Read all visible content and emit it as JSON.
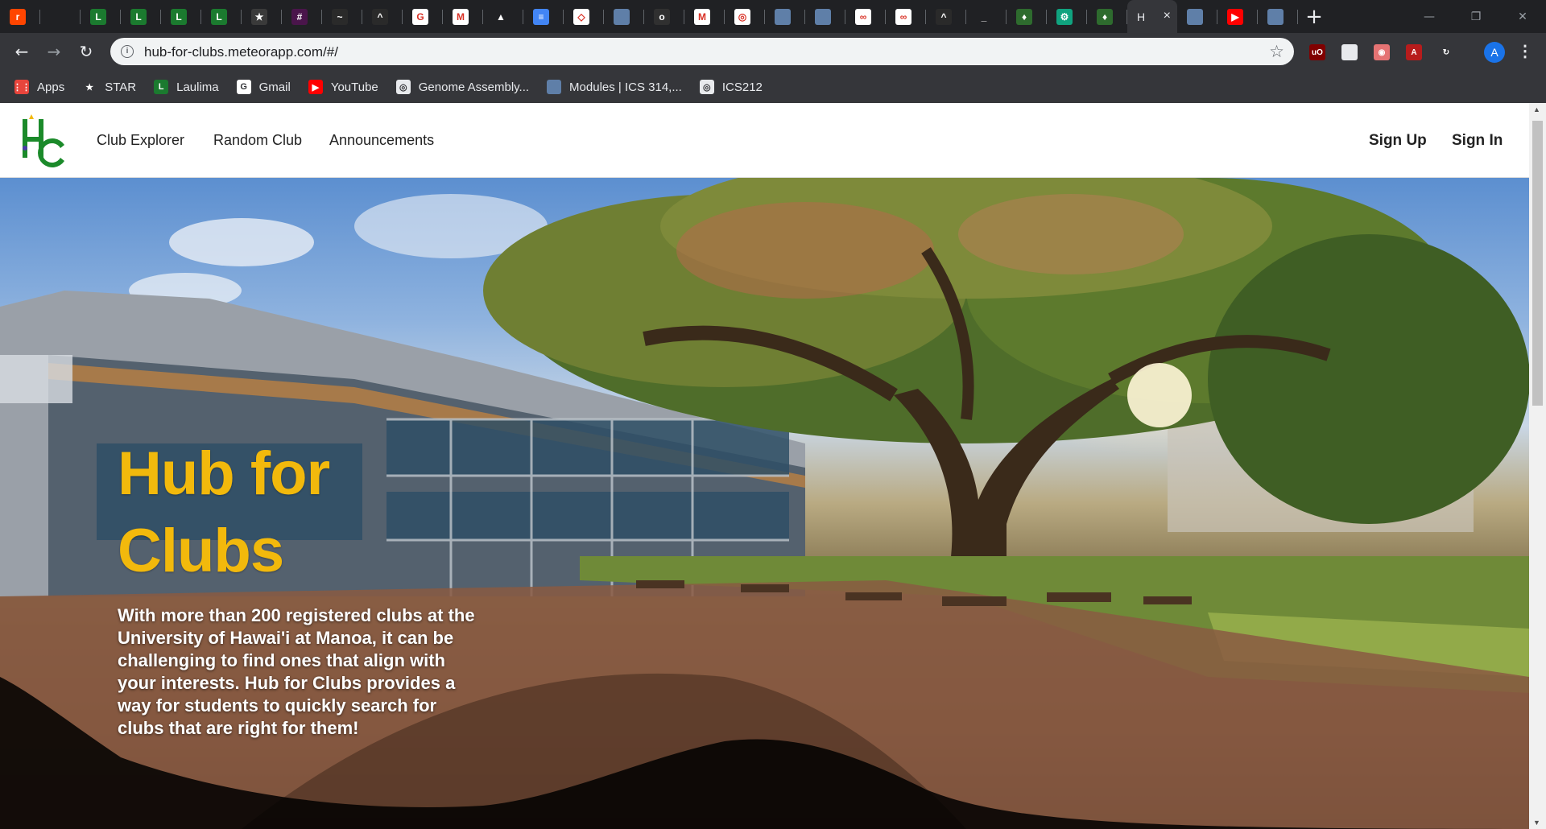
{
  "browser": {
    "tabs": [
      {
        "icon": "reddit-icon",
        "color": "#ff4500",
        "glyph": "r"
      },
      {
        "icon": "blank-tab-icon",
        "color": "#202124",
        "glyph": ""
      },
      {
        "icon": "laulima-icon",
        "color": "#1b7a2f",
        "glyph": "L"
      },
      {
        "icon": "laulima-icon",
        "color": "#1b7a2f",
        "glyph": "L"
      },
      {
        "icon": "laulima-icon",
        "color": "#1b7a2f",
        "glyph": "L"
      },
      {
        "icon": "laulima-icon",
        "color": "#1b7a2f",
        "glyph": "L"
      },
      {
        "icon": "star-icon",
        "color": "#3a3a3a",
        "glyph": "★"
      },
      {
        "icon": "slack-icon",
        "color": "#4a154b",
        "glyph": "#"
      },
      {
        "icon": "feather-icon",
        "color": "#2a2a2a",
        "glyph": "~"
      },
      {
        "icon": "flame-icon",
        "color": "#2a2a2a",
        "glyph": "^"
      },
      {
        "icon": "google-icon",
        "color": "#ffffff",
        "glyph": "G"
      },
      {
        "icon": "gmail-icon",
        "color": "#ffffff",
        "glyph": "M"
      },
      {
        "icon": "drive-icon",
        "color": "#202124",
        "glyph": "▲"
      },
      {
        "icon": "docs-icon",
        "color": "#4285f4",
        "glyph": "≡"
      },
      {
        "icon": "codepen-icon",
        "color": "#ffffff",
        "glyph": "◇"
      },
      {
        "icon": "page-icon",
        "color": "#5f7fa8",
        "glyph": ""
      },
      {
        "icon": "github-icon",
        "color": "#303030",
        "glyph": "o"
      },
      {
        "icon": "mendeley-icon",
        "color": "#ffffff",
        "glyph": "M"
      },
      {
        "icon": "globe-icon",
        "color": "#ffffff",
        "glyph": "◎"
      },
      {
        "icon": "page-icon",
        "color": "#5f7fa8",
        "glyph": ""
      },
      {
        "icon": "page-icon",
        "color": "#5f7fa8",
        "glyph": ""
      },
      {
        "icon": "link-icon",
        "color": "#ffffff",
        "glyph": "∞"
      },
      {
        "icon": "link-icon",
        "color": "#ffffff",
        "glyph": "∞"
      },
      {
        "icon": "flame-icon",
        "color": "#2a2a2a",
        "glyph": "^"
      },
      {
        "icon": "dash-icon",
        "color": "#202124",
        "glyph": "_"
      },
      {
        "icon": "leaf-icon",
        "color": "#2e6b2e",
        "glyph": "♦"
      },
      {
        "icon": "openai-icon",
        "color": "#10a37f",
        "glyph": "⚙"
      },
      {
        "icon": "leaf-icon",
        "color": "#2e6b2e",
        "glyph": "♦"
      }
    ],
    "active_tab": {
      "icon": "hub-for-clubs-icon",
      "title_fragment": "H",
      "close": "×"
    },
    "tabs_after": [
      {
        "icon": "page-icon",
        "color": "#5f7fa8",
        "glyph": ""
      },
      {
        "icon": "youtube-icon",
        "color": "#ff0000",
        "glyph": "▶"
      },
      {
        "icon": "page-icon",
        "color": "#5f7fa8",
        "glyph": ""
      }
    ],
    "new_tab": "+",
    "window_controls": {
      "minimize": "—",
      "maximize": "❐",
      "close": "✕"
    },
    "nav": {
      "back": "←",
      "forward": "→",
      "reload": "↻"
    },
    "url": "hub-for-clubs.meteorapp.com/#/",
    "info_glyph": "i",
    "bookmark_star": "☆",
    "extensions": [
      {
        "icon": "ublock-icon",
        "color": "#800000",
        "glyph": "uO"
      },
      {
        "icon": "document-icon",
        "color": "#e8eaed",
        "glyph": ""
      },
      {
        "icon": "mask-icon",
        "color": "#e57373",
        "glyph": "◉"
      },
      {
        "icon": "pdf-icon",
        "color": "#b71c1c",
        "glyph": "A"
      },
      {
        "icon": "refresh-extension-icon",
        "color": "#35363a",
        "glyph": "↻"
      }
    ],
    "profile_initial": "A",
    "menu_glyph": "⋮",
    "bookmarks": [
      {
        "label": "Apps",
        "icon": "apps-grid-icon",
        "color": "#e8453c",
        "glyph": "⋮⋮"
      },
      {
        "label": "STAR",
        "icon": "star-icon",
        "color": "#35363a",
        "glyph": "★"
      },
      {
        "label": "Laulima",
        "icon": "laulima-icon",
        "color": "#1b7a2f",
        "glyph": "L"
      },
      {
        "label": "Gmail",
        "icon": "google-icon",
        "color": "#ffffff",
        "glyph": "G"
      },
      {
        "label": "YouTube",
        "icon": "youtube-icon",
        "color": "#ff0000",
        "glyph": "▶"
      },
      {
        "label": "Genome Assembly...",
        "icon": "globe-icon",
        "color": "#e8eaed",
        "glyph": "◎"
      },
      {
        "label": "Modules | ICS 314,...",
        "icon": "page-icon",
        "color": "#5f7fa8",
        "glyph": ""
      },
      {
        "label": "ICS212",
        "icon": "globe-icon",
        "color": "#e8eaed",
        "glyph": "◎"
      }
    ]
  },
  "site": {
    "nav": {
      "club_explorer": "Club Explorer",
      "random_club": "Random Club",
      "announcements": "Announcements",
      "sign_up": "Sign Up",
      "sign_in": "Sign In"
    },
    "hero": {
      "heading": "Hub for Clubs",
      "description": "With more than 200 registered clubs at the University of Hawai'i at Manoa, it can be challenging to find ones that align with your interests. Hub for Clubs provides a way for students to quickly search for clubs that are right for them!"
    },
    "colors": {
      "heading": "#f2b90c",
      "logo_green": "#1b8a2a"
    }
  }
}
